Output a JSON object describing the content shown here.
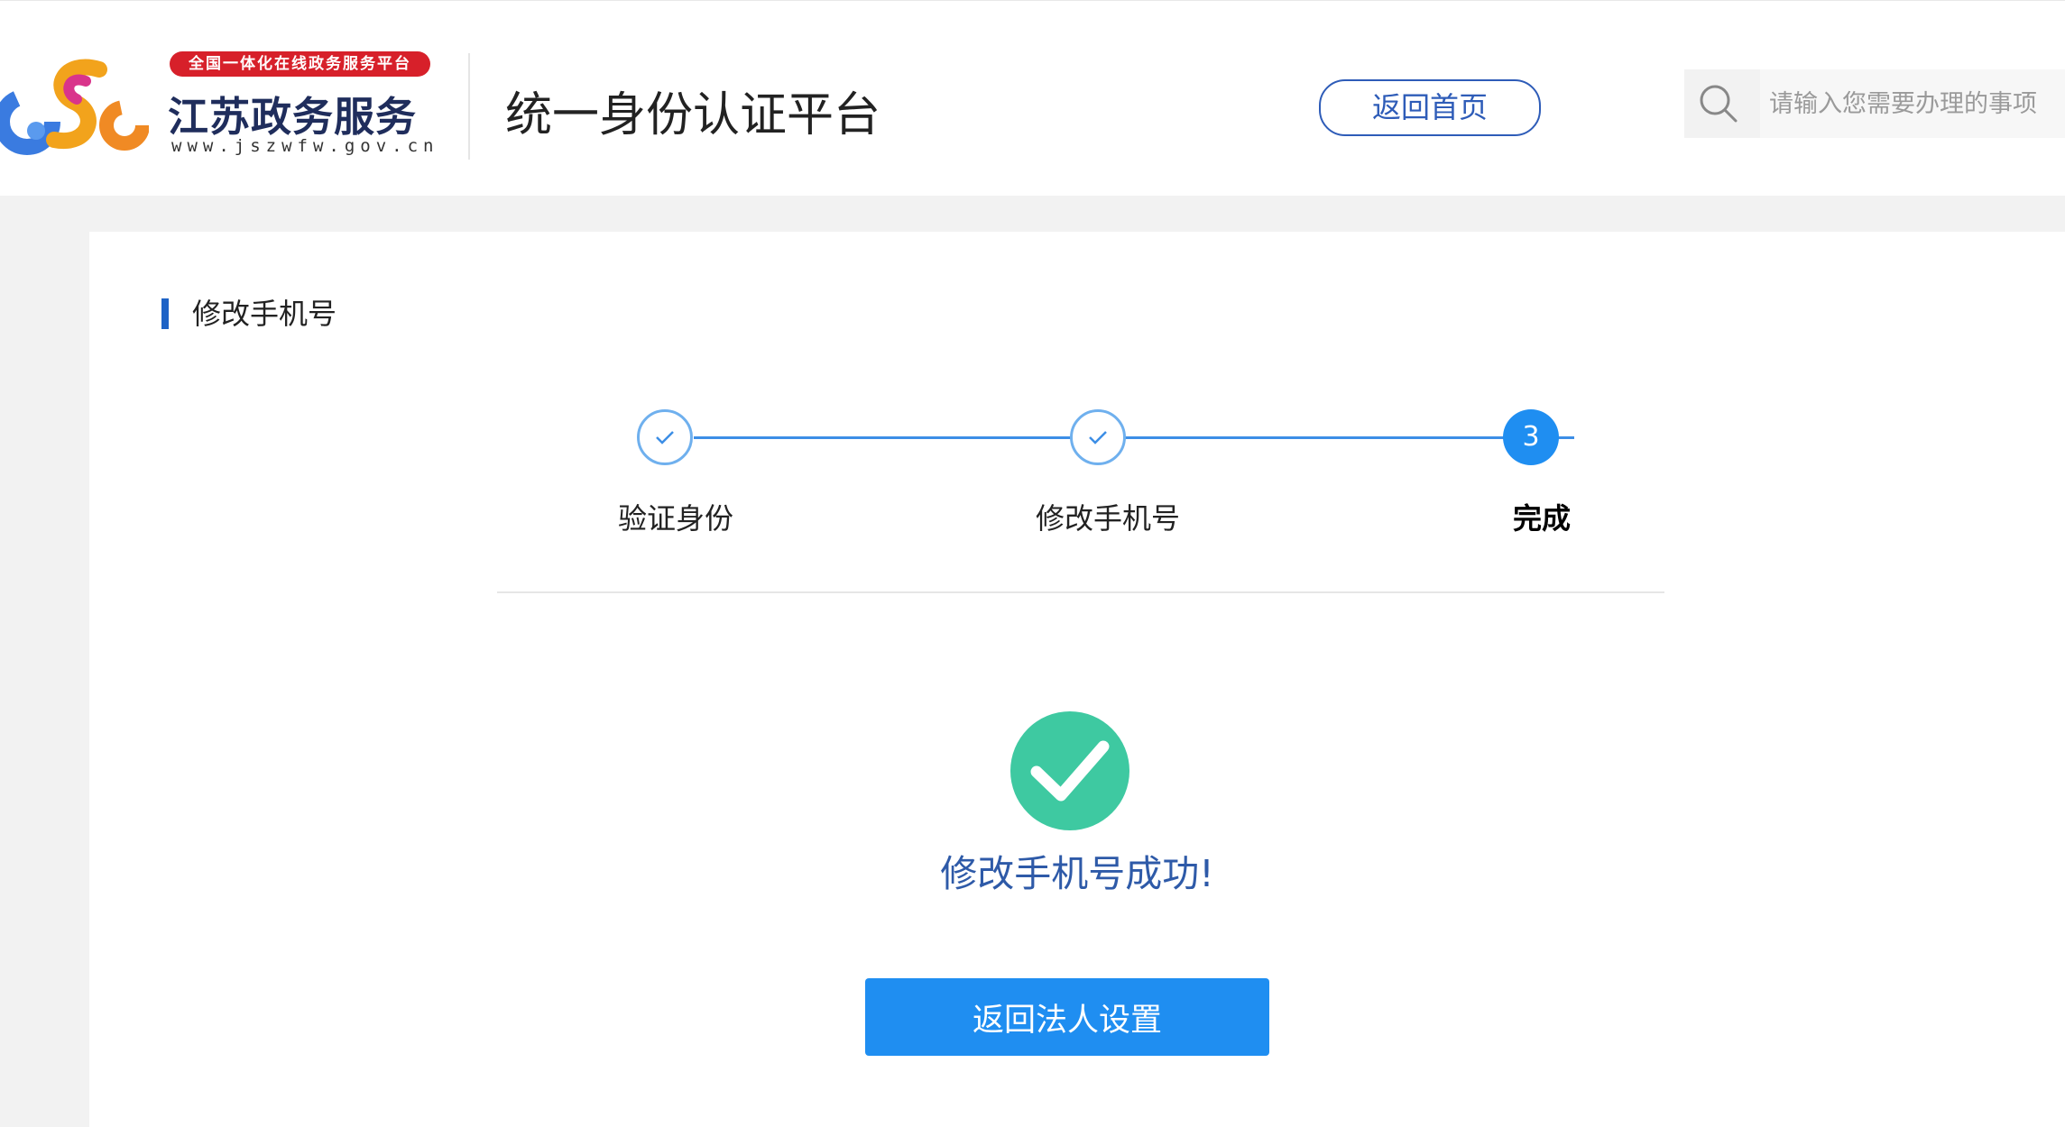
{
  "header": {
    "badge": "全国一体化在线政务服务平台",
    "brand_name": "江苏政务服务",
    "brand_url": "www.jszwfw.gov.cn",
    "platform_title": "统一身份认证平台",
    "home_button": "返回首页",
    "search_placeholder": "请输入您需要办理的事项"
  },
  "main": {
    "section_title": "修改手机号",
    "steps": [
      {
        "label": "验证身份",
        "state": "done"
      },
      {
        "label": "修改手机号",
        "state": "done"
      },
      {
        "label": "完成",
        "number": "3",
        "state": "current"
      }
    ],
    "success_message": "修改手机号成功!",
    "back_button": "返回法人设置"
  },
  "colors": {
    "accent": "#1f8ef1",
    "brand_blue": "#2e5cb8",
    "success_green": "#3ec9a1",
    "badge_red": "#d7202a"
  },
  "icons": {
    "logo": "jszwfw-logo",
    "search": "search-icon",
    "step_done": "check-icon",
    "success": "success-check-icon"
  }
}
